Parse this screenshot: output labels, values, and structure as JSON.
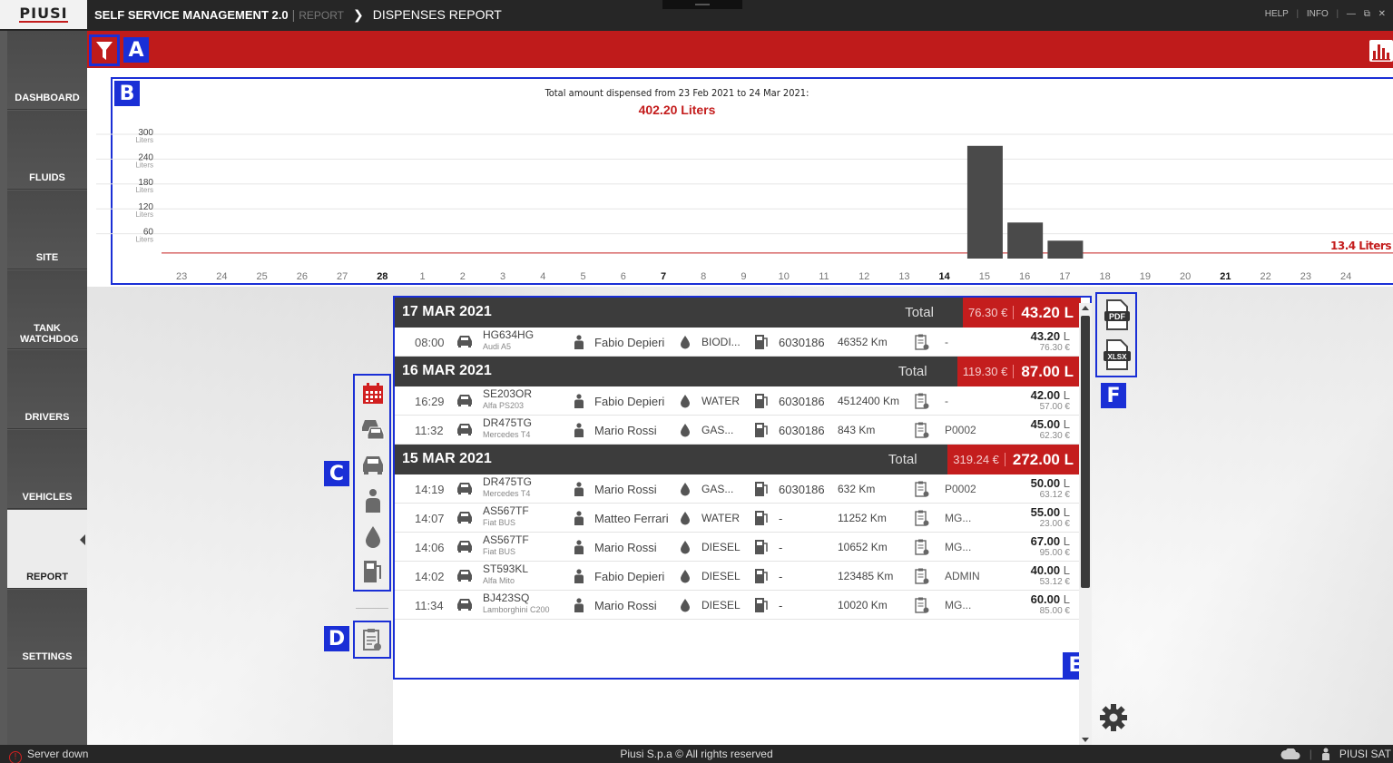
{
  "header": {
    "logo": "PIUSI",
    "app_title": "SELF SERVICE MANAGEMENT 2.0",
    "breadcrumb_parent": "REPORT",
    "page_title": "DISPENSES REPORT",
    "help": "HELP",
    "info": "INFO"
  },
  "sidebar": {
    "items": [
      {
        "label": "DASHBOARD"
      },
      {
        "label": "FLUIDS"
      },
      {
        "label": "SITE"
      },
      {
        "label": "TANK WATCHDOG"
      },
      {
        "label": "DRIVERS"
      },
      {
        "label": "VEHICLES"
      },
      {
        "label": "REPORT"
      },
      {
        "label": "SETTINGS"
      }
    ],
    "active": "REPORT"
  },
  "callouts": {
    "a": "A",
    "b": "B",
    "c": "C",
    "d": "D",
    "e": "E",
    "f": "F"
  },
  "chart_data": {
    "type": "bar",
    "title": "Total amount dispensed from 23 Feb 2021 to 24 Mar 2021:",
    "total": "402.20 Liters",
    "yticks": [
      {
        "value": "300",
        "unit": "Liters"
      },
      {
        "value": "240",
        "unit": "Liters"
      },
      {
        "value": "180",
        "unit": "Liters"
      },
      {
        "value": "120",
        "unit": "Liters"
      },
      {
        "value": "60",
        "unit": "Liters"
      }
    ],
    "ylim": [
      0,
      300
    ],
    "categories": [
      "23",
      "24",
      "25",
      "26",
      "27",
      "28",
      "1",
      "2",
      "3",
      "4",
      "5",
      "6",
      "7",
      "8",
      "9",
      "10",
      "11",
      "12",
      "13",
      "14",
      "15",
      "16",
      "17",
      "18",
      "19",
      "20",
      "21",
      "22",
      "23",
      "24"
    ],
    "bold_categories": [
      "28",
      "7",
      "14",
      "21"
    ],
    "values": [
      0,
      0,
      0,
      0,
      0,
      0,
      0,
      0,
      0,
      0,
      0,
      0,
      0,
      0,
      0,
      0,
      0,
      0,
      0,
      0,
      272,
      87,
      43.2,
      0,
      0,
      0,
      0,
      0,
      0,
      0
    ],
    "average_label": "13.4 Liters",
    "average_value": 13.4,
    "grid": true
  },
  "report": {
    "total_label": "Total",
    "days": [
      {
        "date": "17 MAR 2021",
        "total_eur": "76.30 €",
        "total_liters": "43.20 L",
        "rows": [
          {
            "time": "08:00",
            "plate": "HG634HG",
            "model": "Audi A5",
            "driver": "Fabio Depieri",
            "fluid": "BIODI...",
            "pump": "6030186",
            "km": "46352 Km",
            "code": "-",
            "liters": "43.20",
            "unit": "L",
            "eur": "76.30 €"
          }
        ]
      },
      {
        "date": "16 MAR 2021",
        "total_eur": "119.30 €",
        "total_liters": "87.00 L",
        "rows": [
          {
            "time": "16:29",
            "plate": "SE203OR",
            "model": "Alfa PS203",
            "driver": "Fabio Depieri",
            "fluid": "WATER",
            "pump": "6030186",
            "km": "4512400 Km",
            "code": "-",
            "liters": "42.00",
            "unit": "L",
            "eur": "57.00 €"
          },
          {
            "time": "11:32",
            "plate": "DR475TG",
            "model": "Mercedes T4",
            "driver": "Mario Rossi",
            "fluid": "GAS...",
            "pump": "6030186",
            "km": "843 Km",
            "code": "P0002",
            "liters": "45.00",
            "unit": "L",
            "eur": "62.30 €"
          }
        ]
      },
      {
        "date": "15 MAR 2021",
        "total_eur": "319.24 €",
        "total_liters": "272.00 L",
        "rows": [
          {
            "time": "14:19",
            "plate": "DR475TG",
            "model": "Mercedes T4",
            "driver": "Mario Rossi",
            "fluid": "GAS...",
            "pump": "6030186",
            "km": "632 Km",
            "code": "P0002",
            "liters": "50.00",
            "unit": "L",
            "eur": "63.12 €"
          },
          {
            "time": "14:07",
            "plate": "AS567TF",
            "model": "Fiat BUS",
            "driver": "Matteo Ferrari",
            "fluid": "WATER",
            "pump": "-",
            "km": "11252 Km",
            "code": "MG...",
            "liters": "55.00",
            "unit": "L",
            "eur": "23.00 €"
          },
          {
            "time": "14:06",
            "plate": "AS567TF",
            "model": "Fiat BUS",
            "driver": "Mario Rossi",
            "fluid": "DIESEL",
            "pump": "-",
            "km": "10652 Km",
            "code": "MG...",
            "liters": "67.00",
            "unit": "L",
            "eur": "95.00 €"
          },
          {
            "time": "14:02",
            "plate": "ST593KL",
            "model": "Alfa Mito",
            "driver": "Fabio Depieri",
            "fluid": "DIESEL",
            "pump": "-",
            "km": "123485 Km",
            "code": "ADMIN",
            "liters": "40.00",
            "unit": "L",
            "eur": "53.12 €"
          },
          {
            "time": "11:34",
            "plate": "BJ423SQ",
            "model": "Lamborghini C200",
            "driver": "Mario Rossi",
            "fluid": "DIESEL",
            "pump": "-",
            "km": "10020 Km",
            "code": "MG...",
            "liters": "60.00",
            "unit": "L",
            "eur": "85.00 €"
          }
        ]
      }
    ]
  },
  "export": {
    "pdf": "PDF",
    "xlsx": "XLSX"
  },
  "filter_icons": [
    "calendar-icon",
    "vehicles-icon",
    "car-icon",
    "driver-icon",
    "fluid-icon",
    "pump-icon"
  ],
  "statusbar": {
    "server_status": "Server down",
    "copyright": "Piusi S.p.a © All rights reserved",
    "user": "PIUSI SAT"
  },
  "colors": {
    "accent": "#bf1b1b",
    "dark": "#3c3c3c",
    "callout": "#1a2fd6"
  }
}
